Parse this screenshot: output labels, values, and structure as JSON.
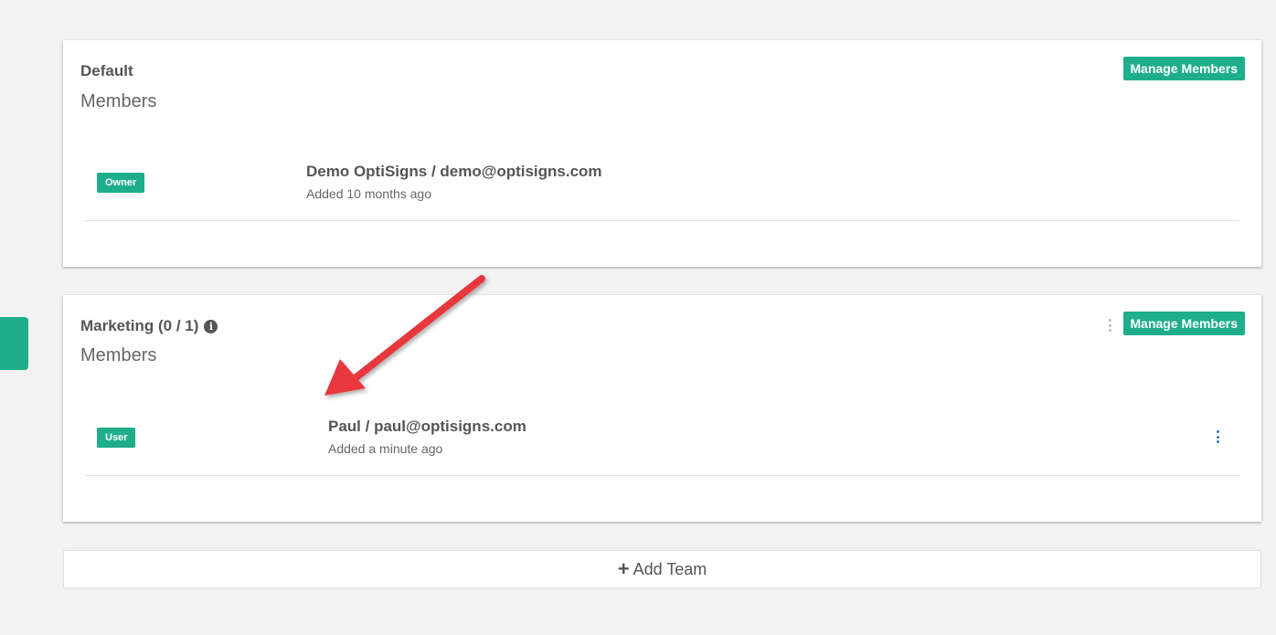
{
  "teams": [
    {
      "title": "Default",
      "members_label": "Members",
      "manage_label": "Manage Members",
      "members": [
        {
          "role": "Owner",
          "name": "Demo OptiSigns / demo@optisigns.com",
          "added": "Added 10 months ago"
        }
      ]
    },
    {
      "title": "Marketing (0 / 1)",
      "members_label": "Members",
      "manage_label": "Manage Members",
      "members": [
        {
          "role": "User",
          "name": "Paul / paul@optisigns.com",
          "added": "Added a minute ago"
        }
      ]
    }
  ],
  "add_team_label": "Add Team",
  "colors": {
    "accent": "#1fae8b",
    "arrow": "#e8383d",
    "link": "#337ab7"
  },
  "icons": {
    "info": "info-circle-icon",
    "add": "plus-icon",
    "menu": "vertical-ellipsis-icon"
  }
}
